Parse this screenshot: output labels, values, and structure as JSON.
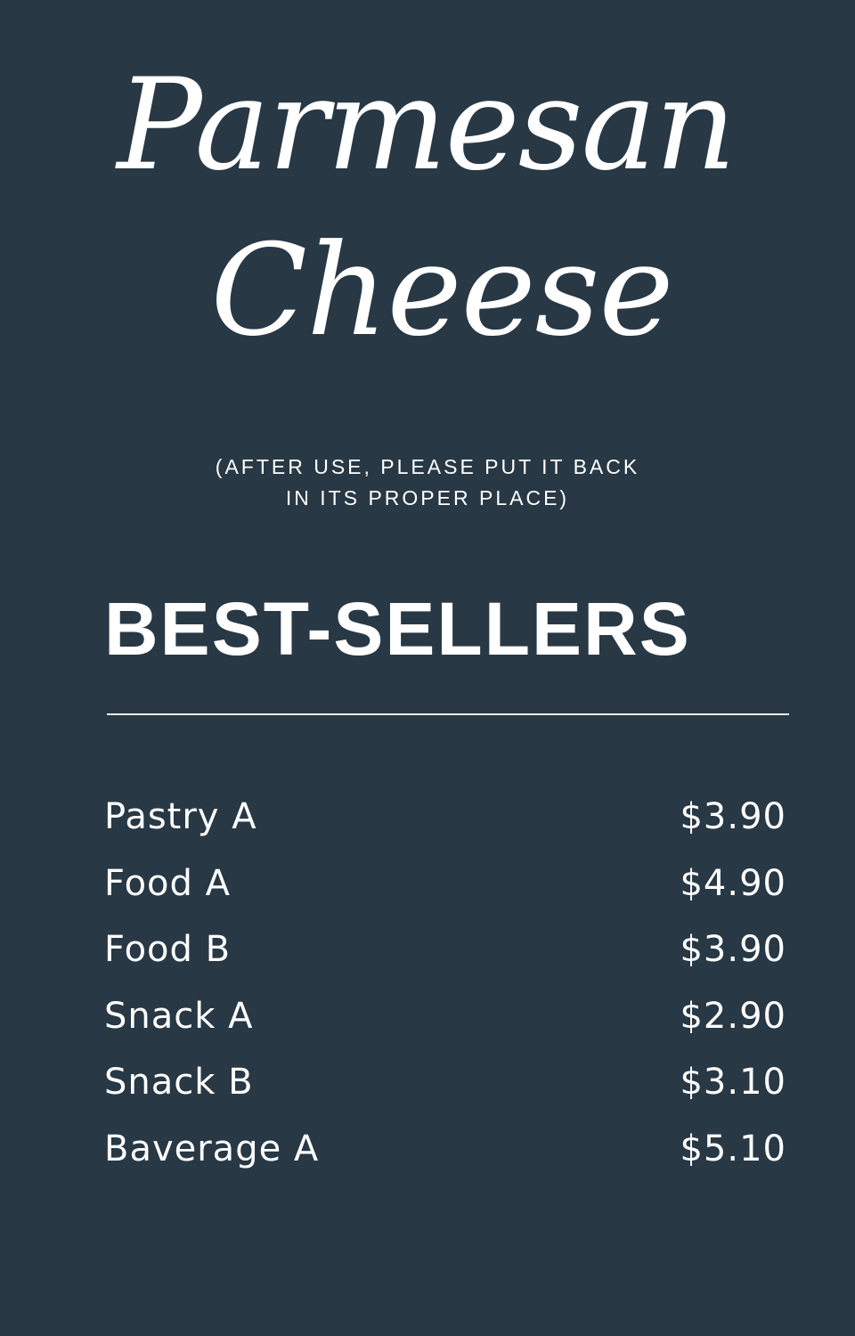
{
  "title": {
    "line1": "Parmesan",
    "line2": "Cheese"
  },
  "notice": {
    "line1": "(AFTER USE, PLEASE PUT IT BACK",
    "line2": "IN ITS PROPER PLACE)"
  },
  "section": {
    "heading": "BEST-SELLERS"
  },
  "menu": {
    "items": [
      {
        "name": "Pastry A",
        "price": "$3.90"
      },
      {
        "name": "Food A",
        "price": "$4.90"
      },
      {
        "name": "Food B",
        "price": "$3.90"
      },
      {
        "name": "Snack A",
        "price": "$2.90"
      },
      {
        "name": "Snack B",
        "price": "$3.10"
      },
      {
        "name": "Baverage A",
        "price": "$5.10"
      }
    ]
  },
  "colors": {
    "background": "#283845",
    "text": "#ffffff"
  }
}
